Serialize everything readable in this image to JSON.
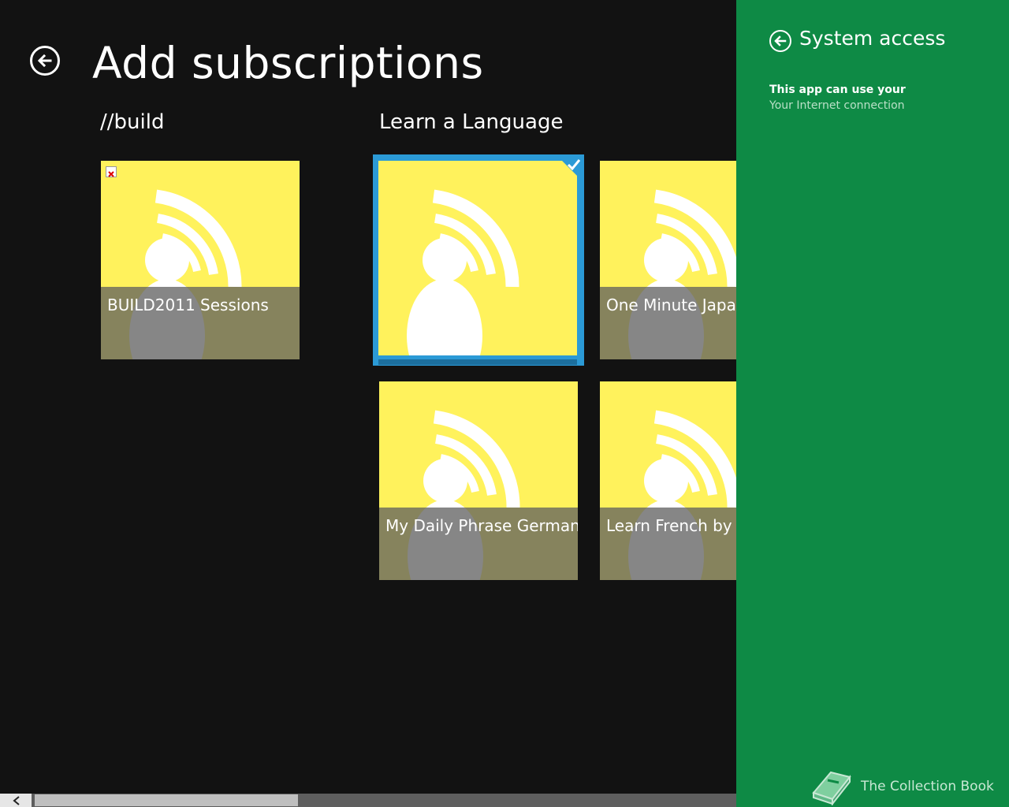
{
  "page": {
    "title": "Add subscriptions"
  },
  "groups": [
    {
      "name": "//build"
    },
    {
      "name": "Learn a Language"
    }
  ],
  "tiles": [
    {
      "label": "BUILD2011 Sessions",
      "selected": false,
      "broken_image": true
    },
    {
      "label": "",
      "selected": true
    },
    {
      "label": "One Minute Japar",
      "selected": false
    },
    {
      "label": "My Daily Phrase German",
      "selected": false
    },
    {
      "label": "Learn French by P",
      "selected": false
    }
  ],
  "panel": {
    "title": "System access",
    "permission_label": "This app can use your",
    "permission_value": "Your Internet connection"
  },
  "brand": {
    "text": "The Collection Book"
  },
  "colors": {
    "background": "#121212",
    "tile": "#fff25c",
    "tile_overlay": "#5d5d5d",
    "selection": "#2b9ad6",
    "panel": "#0e8a45"
  },
  "icons": {
    "back": "back-arrow-icon",
    "podcast": "podcast-icon",
    "check": "checkmark-icon",
    "brand": "book-icon"
  }
}
